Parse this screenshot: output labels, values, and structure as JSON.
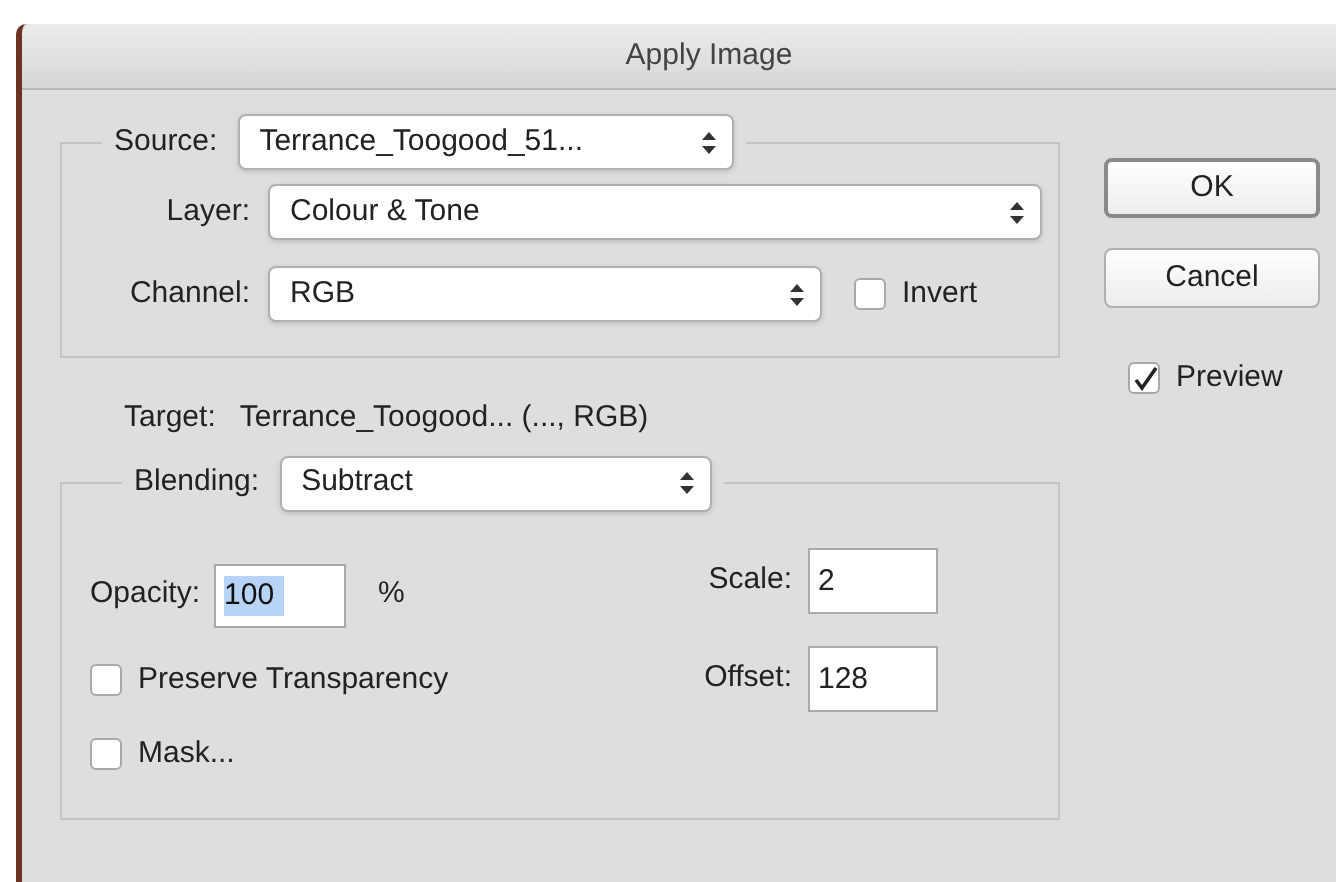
{
  "window": {
    "title": "Apply Image"
  },
  "source": {
    "label": "Source:",
    "value": "Terrance_Toogood_51..."
  },
  "layer": {
    "label": "Layer:",
    "value": "Colour & Tone"
  },
  "channel": {
    "label": "Channel:",
    "value": "RGB"
  },
  "invert": {
    "label": "Invert",
    "checked": false
  },
  "target": {
    "label": "Target:",
    "value": "Terrance_Toogood... (..., RGB)"
  },
  "blending": {
    "label": "Blending:",
    "value": "Subtract"
  },
  "opacity": {
    "label": "Opacity:",
    "value": "100",
    "unit": "%",
    "selected": true
  },
  "scale": {
    "label": "Scale:",
    "value": "2"
  },
  "offset": {
    "label": "Offset:",
    "value": "128"
  },
  "preserve_transparency": {
    "label": "Preserve Transparency",
    "checked": false
  },
  "mask": {
    "label": "Mask...",
    "checked": false
  },
  "buttons": [
    {
      "label": "OK",
      "default": true
    },
    {
      "label": "Cancel",
      "default": false
    }
  ],
  "preview": {
    "label": "Preview",
    "checked": true
  }
}
